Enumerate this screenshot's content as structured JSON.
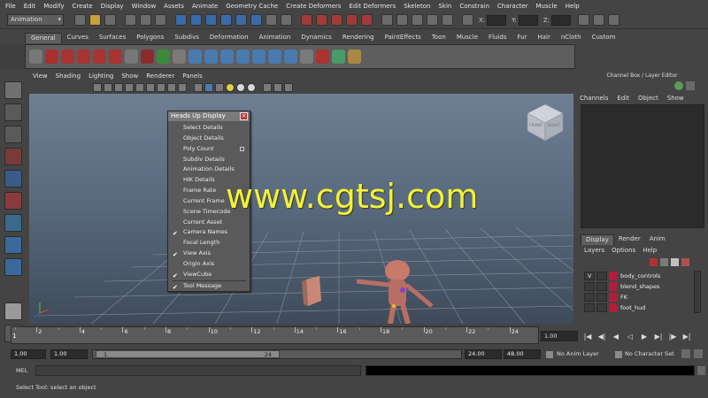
{
  "menubar": [
    "File",
    "Edit",
    "Modify",
    "Create",
    "Display",
    "Window",
    "Assets",
    "Animate",
    "Geometry Cache",
    "Create Deformers",
    "Edit Deformers",
    "Skeleton",
    "Skin",
    "Constrain",
    "Character",
    "Muscle",
    "Help"
  ],
  "status_line": {
    "mode": "Animation",
    "x_label": "X:",
    "y_label": "Y:",
    "z_label": "Z:"
  },
  "shelf_tabs": [
    "General",
    "Curves",
    "Surfaces",
    "Polygons",
    "Subdivs",
    "Deformation",
    "Animation",
    "Dynamics",
    "Rendering",
    "PaintEffects",
    "Toon",
    "Muscle",
    "Fluids",
    "Fur",
    "Hair",
    "nCloth",
    "Custom"
  ],
  "shelf_active_tab": "General",
  "panel_menu": [
    "View",
    "Shading",
    "Lighting",
    "Show",
    "Renderer",
    "Panels"
  ],
  "hud": {
    "title": "Heads Up Display",
    "items": [
      {
        "label": "Select Details",
        "checked": false
      },
      {
        "label": "Object Details",
        "checked": false
      },
      {
        "label": "Poly Count",
        "checked": false,
        "option_box": true
      },
      {
        "label": "Subdiv Details",
        "checked": false
      },
      {
        "label": "Animation Details",
        "checked": false
      },
      {
        "label": "HIK Details",
        "checked": false
      },
      {
        "label": "Frame Rate",
        "checked": false
      },
      {
        "label": "Current Frame",
        "checked": false
      },
      {
        "label": "Scene Timecode",
        "checked": false
      },
      {
        "label": "Current Asset",
        "checked": false
      },
      {
        "label": "Camera Names",
        "checked": true
      },
      {
        "label": "Focal Length",
        "checked": false
      },
      {
        "label": "View Axis",
        "checked": true
      },
      {
        "label": "Origin Axis",
        "checked": false
      },
      {
        "label": "ViewCube",
        "checked": true
      },
      {
        "label": "Tool Message",
        "checked": true
      }
    ]
  },
  "watermark": "www.cgtsj.com",
  "viewcube": {
    "front": "FRONT",
    "right": "RIGHT"
  },
  "channel_box": {
    "title": "Channel Box / Layer Editor",
    "menu": [
      "Channels",
      "Edit",
      "Object",
      "Show"
    ]
  },
  "layer_editor": {
    "tabs": [
      "Display",
      "Render",
      "Anim"
    ],
    "active_tab": "Display",
    "menu": [
      "Layers",
      "Options",
      "Help"
    ],
    "layers": [
      {
        "visible": "V",
        "name": "body_controls"
      },
      {
        "visible": "",
        "name": "blend_shapes"
      },
      {
        "visible": "",
        "name": "FK"
      },
      {
        "visible": "",
        "name": "foot_hud"
      }
    ]
  },
  "time_slider": {
    "ticks": [
      "2",
      "4",
      "6",
      "8",
      "10",
      "12",
      "14",
      "16",
      "18",
      "20",
      "22",
      "24"
    ],
    "first_label": "1",
    "current_frame": "1.00"
  },
  "range": {
    "start_time": "1.00",
    "playback_start": "1.00",
    "slider_start": "1",
    "slider_end": "24",
    "playback_end": "24.00",
    "end_time": "48.00",
    "anim_layer": "No Anim Layer",
    "character_set": "No Character Set"
  },
  "command_line": {
    "label": "MEL"
  },
  "help_line": "Select Tool: select an object",
  "colors": {
    "watermark": "#f2f23a",
    "layer_color": "#b01e3a",
    "viewport_top": "#6e7f94",
    "viewport_bottom": "#3f4b5a"
  }
}
